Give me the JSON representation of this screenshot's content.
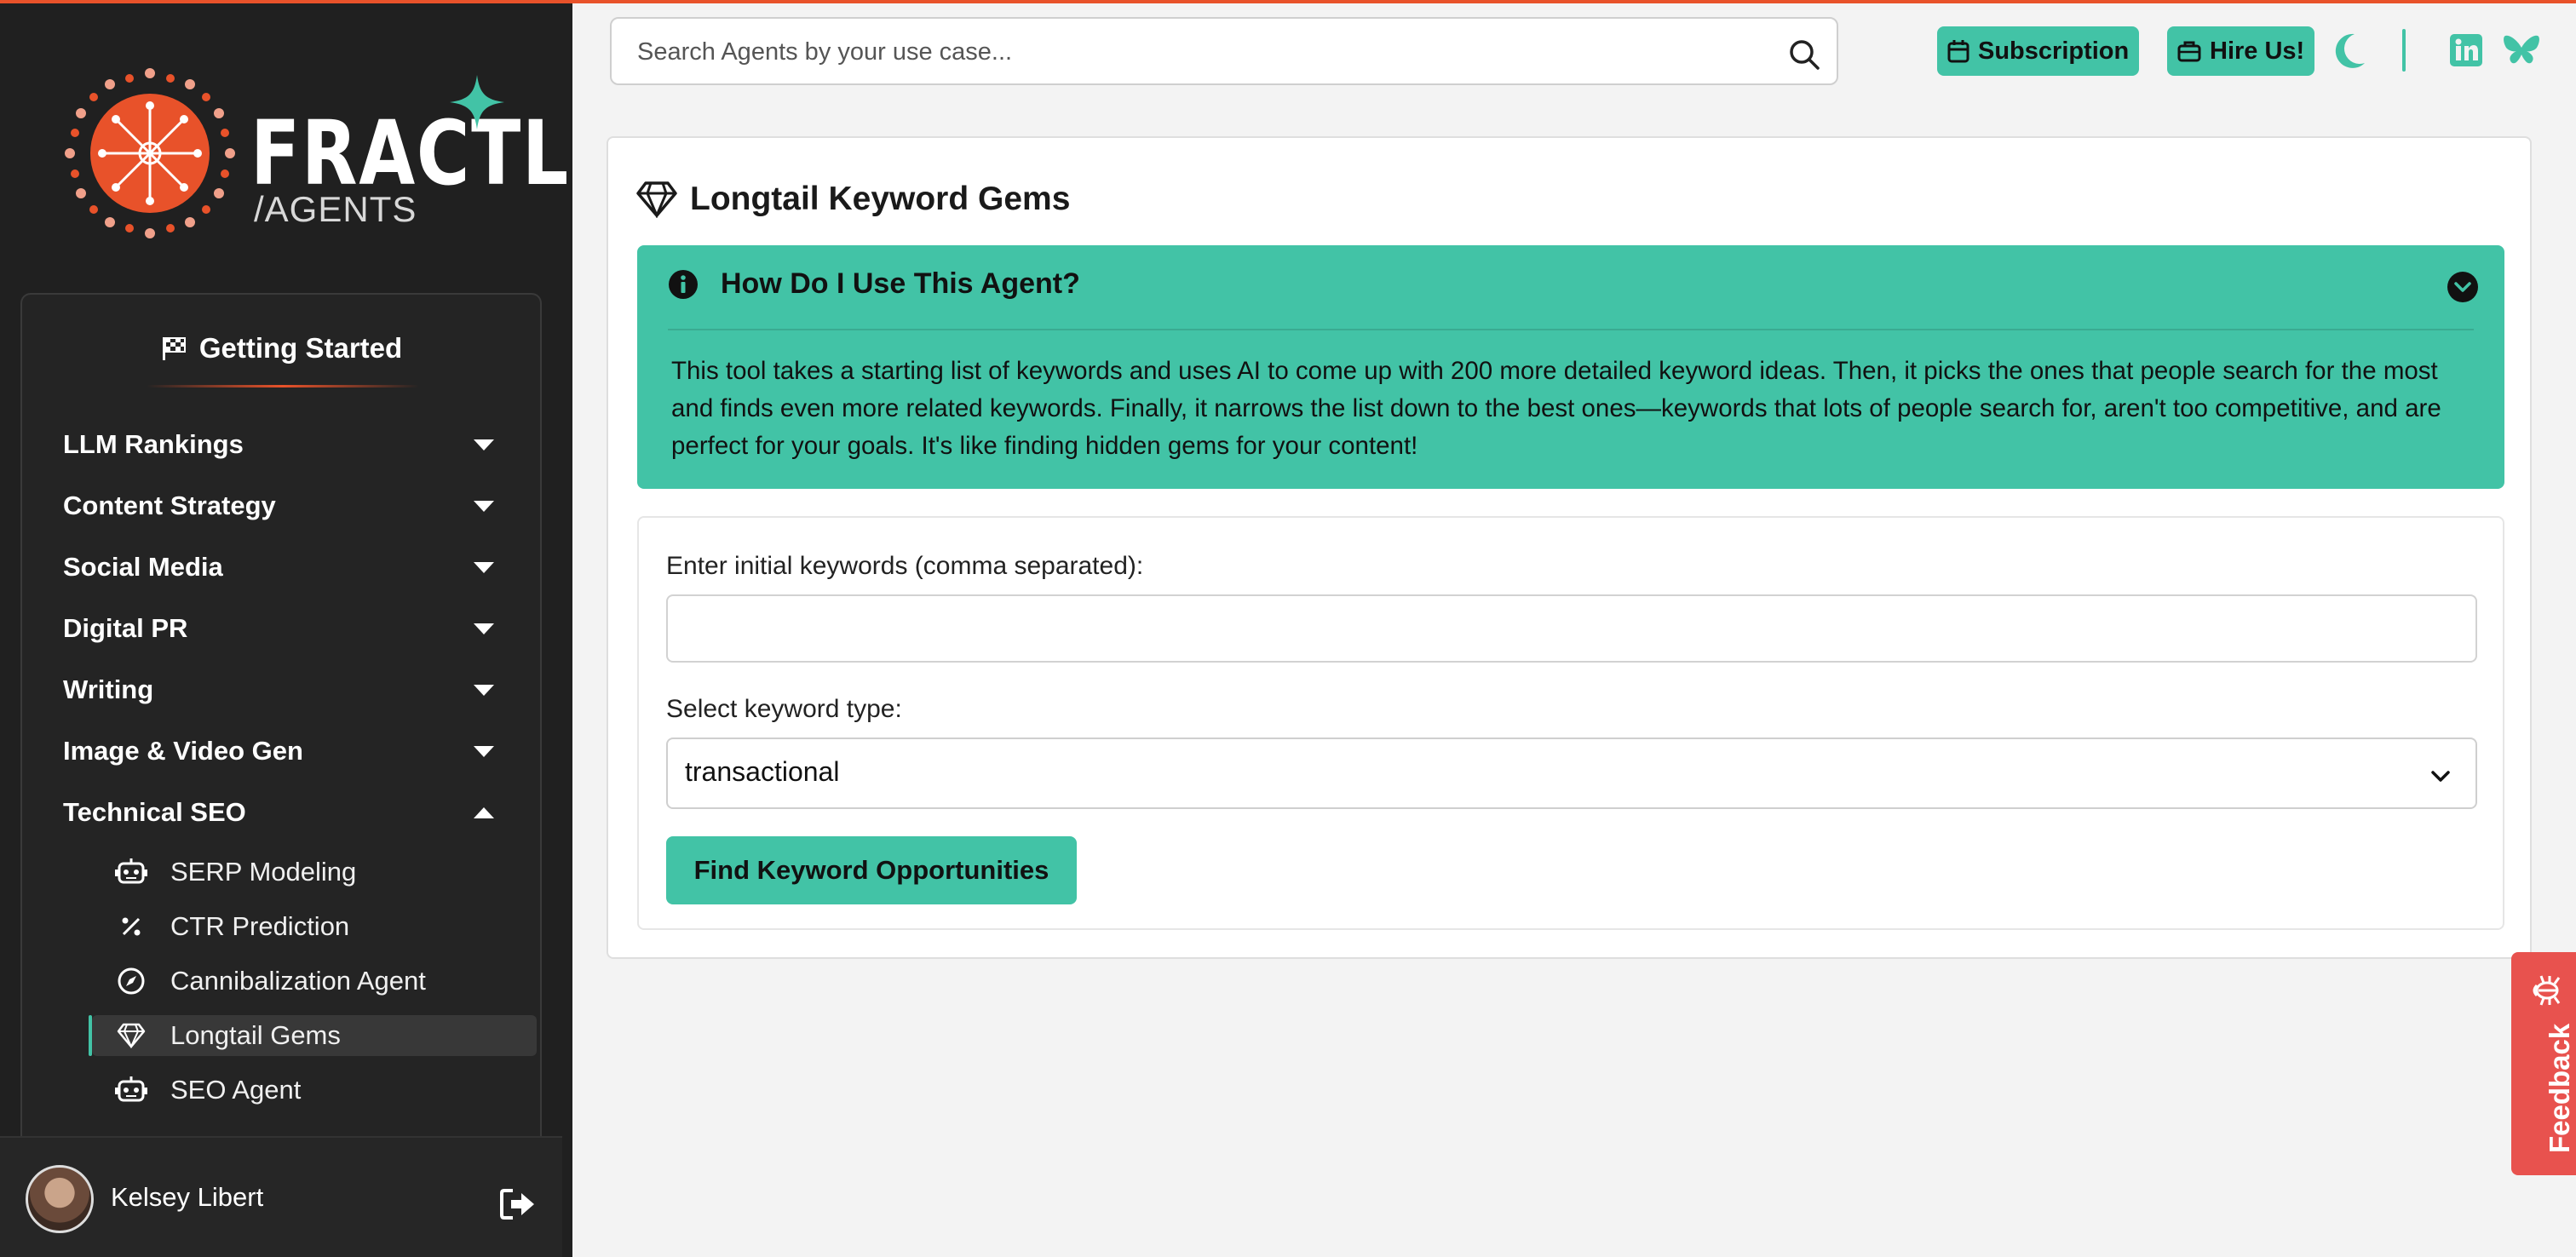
{
  "brand": {
    "wordmark": "FRACTL",
    "subline": "/AGENTS",
    "colors": {
      "accent": "#42c3a6",
      "brand": "#e8522a",
      "sidebar": "#202020",
      "feedback": "#e8524e"
    }
  },
  "sidebar": {
    "section_title": "Getting Started",
    "categories": [
      {
        "label": "LLM Rankings",
        "state": "collapsed"
      },
      {
        "label": "Content Strategy",
        "state": "collapsed"
      },
      {
        "label": "Social Media",
        "state": "collapsed"
      },
      {
        "label": "Digital PR",
        "state": "collapsed"
      },
      {
        "label": "Writing",
        "state": "collapsed"
      },
      {
        "label": "Image & Video Gen",
        "state": "collapsed"
      },
      {
        "label": "Technical SEO",
        "state": "expanded"
      }
    ],
    "technical_seo_items": [
      {
        "label": "SERP Modeling",
        "icon": "robot-icon"
      },
      {
        "label": "CTR Prediction",
        "icon": "percent-icon"
      },
      {
        "label": "Cannibalization Agent",
        "icon": "compass-icon"
      },
      {
        "label": "Longtail Gems",
        "icon": "gem-icon",
        "active": true
      },
      {
        "label": "SEO Agent",
        "icon": "robot-icon"
      }
    ]
  },
  "user": {
    "name": "Kelsey Libert"
  },
  "topbar": {
    "search_placeholder": "Search Agents by your use case...",
    "subscription_label": "Subscription",
    "hire_label": "Hire Us!"
  },
  "main": {
    "title": "Longtail Keyword Gems",
    "howto": {
      "heading": "How Do I Use This Agent?",
      "body": "This tool takes a starting list of keywords and uses AI to come up with 200 more detailed keyword ideas. Then, it picks the ones that people search for the most and finds even more related keywords. Finally, it narrows the list down to the best ones—keywords that lots of people search for, aren't too competitive, and are perfect for your goals. It's like finding hidden gems for your content!"
    },
    "form": {
      "keywords_label": "Enter initial keywords (comma separated):",
      "keywords_value": "",
      "type_label": "Select keyword type:",
      "type_value": "transactional",
      "submit_label": "Find Keyword Opportunities"
    }
  },
  "feedback": {
    "label": "Feedback"
  }
}
